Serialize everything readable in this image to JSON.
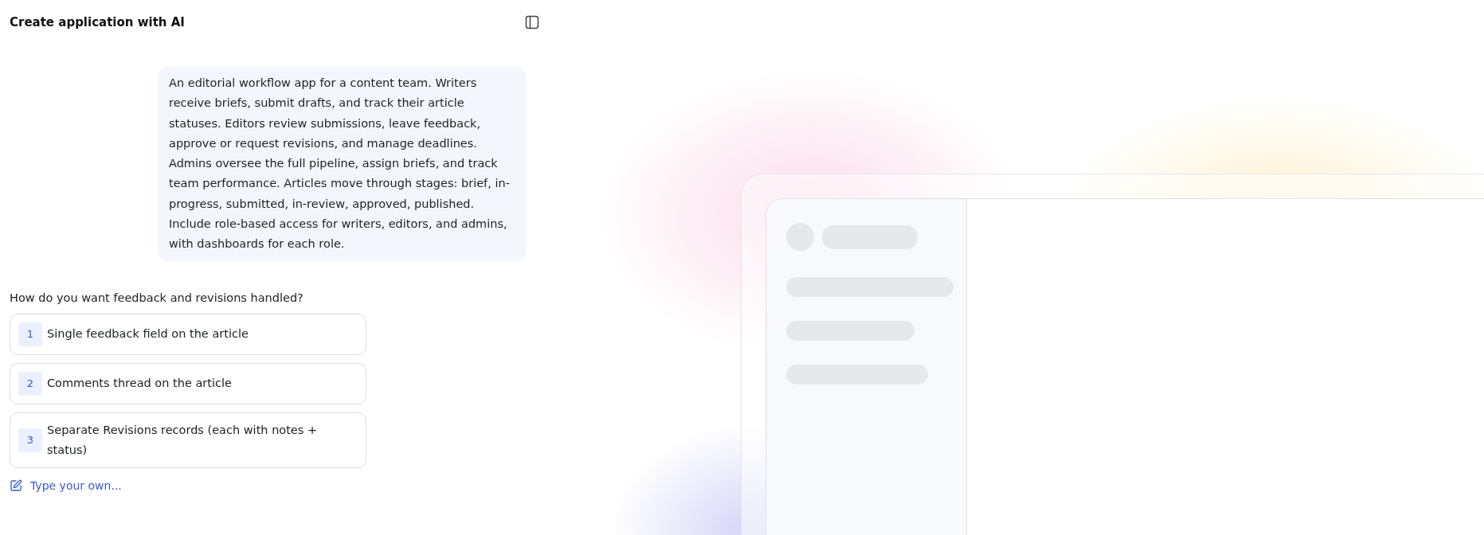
{
  "panel": {
    "title": "Create application with AI"
  },
  "prompt": "An editorial workflow app for a content team. Writers receive briefs, submit drafts, and track their article statuses. Editors review submissions, leave feedback, approve or request revisions, and manage deadlines. Admins oversee the full pipeline, assign briefs, and track team performance. Articles move through stages: brief, in-progress, submitted, in-review, approved, published. Include role-based access for writers, editors, and admins, with dashboards for each role.",
  "question": {
    "text": "How do you want feedback and revisions handled?",
    "options": [
      {
        "number": "1",
        "label": "Single feedback field on the article"
      },
      {
        "number": "2",
        "label": "Comments thread on the article"
      },
      {
        "number": "3",
        "label": "Separate Revisions records (each with notes + status)"
      }
    ],
    "custom": "Type your own..."
  }
}
